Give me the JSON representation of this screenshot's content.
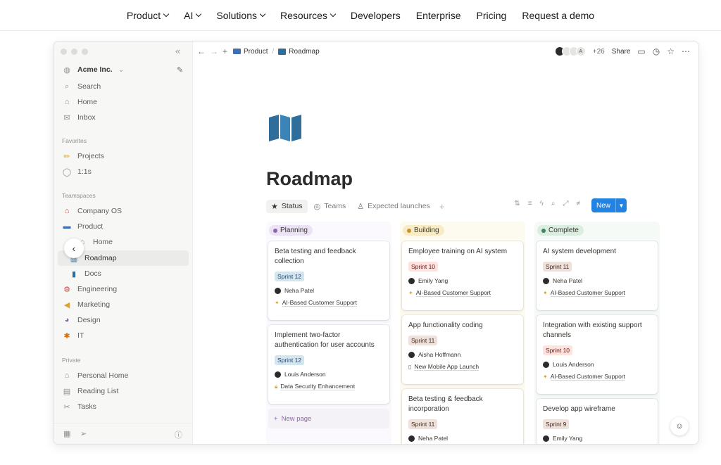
{
  "site_nav": {
    "items": [
      {
        "label": "Product",
        "dropdown": true
      },
      {
        "label": "AI",
        "dropdown": true
      },
      {
        "label": "Solutions",
        "dropdown": true
      },
      {
        "label": "Resources",
        "dropdown": true
      },
      {
        "label": "Developers",
        "dropdown": false
      },
      {
        "label": "Enterprise",
        "dropdown": false
      },
      {
        "label": "Pricing",
        "dropdown": false
      },
      {
        "label": "Request a demo",
        "dropdown": false
      }
    ]
  },
  "sidebar": {
    "workspace": "Acme Inc.",
    "top_items": [
      {
        "label": "Search",
        "icon": "search-icon"
      },
      {
        "label": "Home",
        "icon": "home-icon"
      },
      {
        "label": "Inbox",
        "icon": "inbox-icon"
      }
    ],
    "favorites_title": "Favorites",
    "favorites": [
      {
        "label": "Projects",
        "icon": "pencil-icon"
      },
      {
        "label": "1:1s",
        "icon": "chat-icon"
      }
    ],
    "teamspaces_title": "Teamspaces",
    "teamspaces": [
      {
        "label": "Company OS",
        "icon": "house-icon"
      },
      {
        "label": "Product",
        "icon": "monitor-icon"
      },
      {
        "label": "Home",
        "icon": "home-icon"
      },
      {
        "label": "Roadmap",
        "icon": "map-icon",
        "selected": true
      },
      {
        "label": "Docs",
        "icon": "bookmark-icon"
      },
      {
        "label": "Engineering",
        "icon": "gear-icon"
      },
      {
        "label": "Marketing",
        "icon": "megaphone-icon"
      },
      {
        "label": "Design",
        "icon": "palette-icon"
      },
      {
        "label": "IT",
        "icon": "bug-icon"
      }
    ],
    "private_title": "Private",
    "private": [
      {
        "label": "Personal Home",
        "icon": "home-icon"
      },
      {
        "label": "Reading List",
        "icon": "list-icon"
      },
      {
        "label": "Tasks",
        "icon": "tools-icon"
      }
    ]
  },
  "topbar": {
    "breadcrumb": [
      "Product",
      "Roadmap"
    ],
    "share_count": "+26",
    "share_label": "Share"
  },
  "page": {
    "title": "Roadmap",
    "views": [
      {
        "label": "Status",
        "active": true
      },
      {
        "label": "Teams",
        "active": false
      },
      {
        "label": "Expected launches",
        "active": false
      }
    ],
    "new_label": "New"
  },
  "board": {
    "columns": [
      {
        "name": "Planning",
        "cards": [
          {
            "title": "Beta testing and feedback collection",
            "sprint": "Sprint 12",
            "person": "Neha Patel",
            "project": "AI-Based Customer Support"
          },
          {
            "title": "Implement two-factor authentication for user accounts",
            "sprint": "Sprint 12",
            "person": "Louis Anderson",
            "project": "Data Security Enhancement"
          }
        ],
        "new_page": "New page"
      },
      {
        "name": "Building",
        "cards": [
          {
            "title": "Employee training on AI system",
            "sprint": "Sprint 10",
            "person": "Emily Yang",
            "project": "AI-Based Customer Support"
          },
          {
            "title": "App functionality coding",
            "sprint": "Sprint 11",
            "person": "Aisha Hoffmann",
            "project": "New Mobile App Launch"
          },
          {
            "title": "Beta testing & feedback incorporation",
            "sprint": "Sprint 11",
            "person": "Neha Patel"
          }
        ]
      },
      {
        "name": "Complete",
        "cards": [
          {
            "title": "AI system development",
            "sprint": "Sprint 11",
            "person": "Neha Patel",
            "project": "AI-Based Customer Support"
          },
          {
            "title": "Integration with existing support channels",
            "sprint": "Sprint 10",
            "person": "Louis Anderson",
            "project": "AI-Based Customer Support"
          },
          {
            "title": "Develop app wireframe",
            "sprint": "Sprint 9",
            "person": "Emily Yang"
          }
        ]
      }
    ]
  },
  "colors": {
    "accent_blue": "#2383e2",
    "planning": "#9065b0",
    "building": "#cb912f",
    "complete": "#448361"
  }
}
